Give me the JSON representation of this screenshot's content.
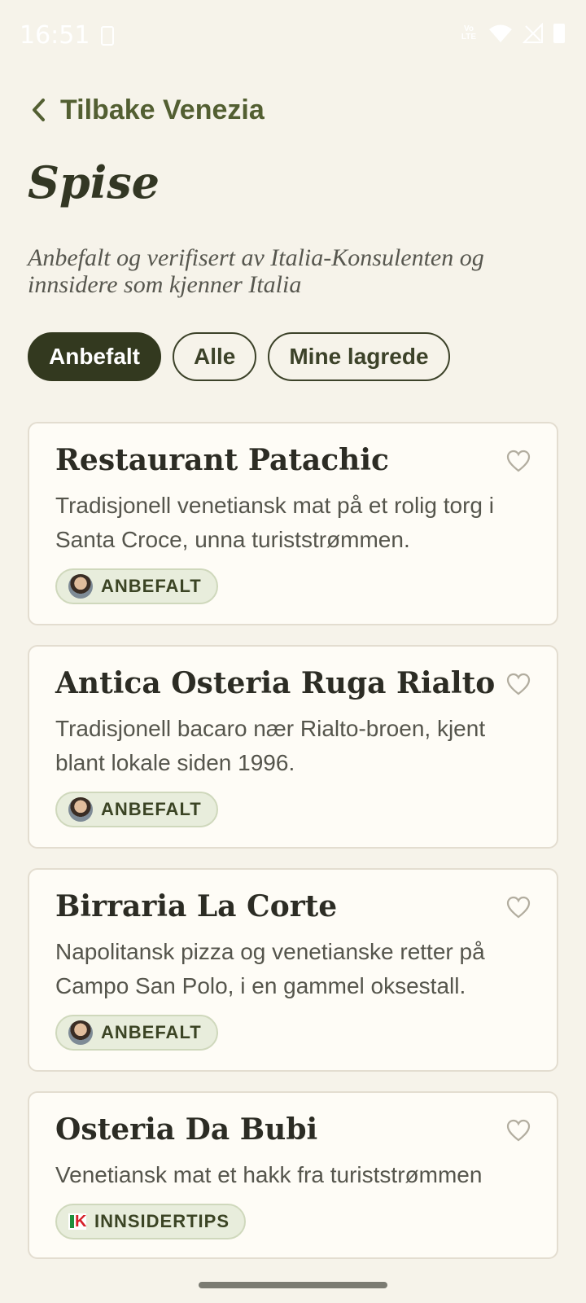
{
  "status_bar": {
    "time": "16:51",
    "network": "Vo LTE",
    "icons": [
      "phone-icon",
      "wifi-icon",
      "signal-icon",
      "battery-icon"
    ]
  },
  "header": {
    "back_label": "Tilbake Venezia",
    "title": "Spise",
    "subtitle": "Anbefalt og verifisert av Italia-Konsulenten og innsidere som kjenner Italia"
  },
  "filters": [
    {
      "label": "Anbefalt",
      "active": true
    },
    {
      "label": "Alle",
      "active": false
    },
    {
      "label": "Mine lagrede",
      "active": false
    }
  ],
  "restaurants": [
    {
      "name": "Restaurant Patachic",
      "description": "Tradisjonell venetiansk mat på et rolig torg i Santa Croce, unna turiststrømmen.",
      "badge": "ANBEFALT",
      "badge_icon": "consultant-avatar"
    },
    {
      "name": "Antica Osteria Ruga Rialto",
      "description": "Tradisjonell bacaro nær Rialto-broen, kjent blant lokale siden 1996.",
      "badge": "ANBEFALT",
      "badge_icon": "consultant-avatar"
    },
    {
      "name": "Birraria La Corte",
      "description": "Napolitansk pizza og venetianske retter på Campo San Polo, i en gammel oksestall.",
      "badge": "ANBEFALT",
      "badge_icon": "consultant-avatar"
    },
    {
      "name": "Osteria Da Bubi",
      "description": "Venetiansk mat et hakk fra turiststrømmen",
      "badge": "INNSIDERTIPS",
      "badge_icon": "ik-logo"
    }
  ],
  "colors": {
    "background": "#f6f3ea",
    "accent_dark": "#33391f",
    "accent_text": "#535f32",
    "card": "#fefcf6",
    "badge_bg": "#e8eddc"
  }
}
